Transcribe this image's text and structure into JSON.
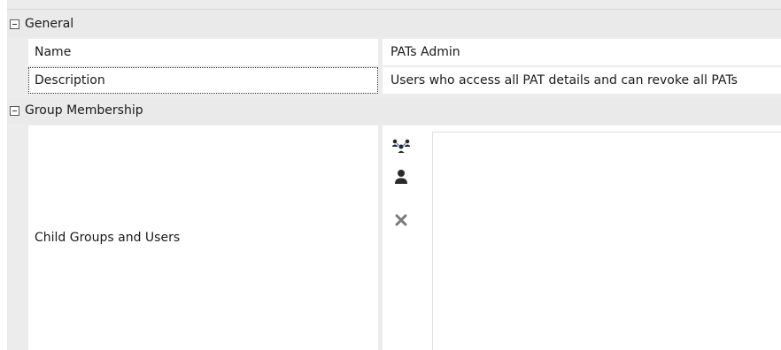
{
  "categories": {
    "general": "General",
    "group_membership": "Group Membership"
  },
  "properties": {
    "name": {
      "label": "Name",
      "value": "PATs Admin"
    },
    "description": {
      "label": "Description",
      "value": "Users who access all PAT details and can revoke all PATs"
    },
    "child_groups_and_users": {
      "label": "Child Groups and Users"
    }
  },
  "icons": {
    "add_group": "group-add-icon",
    "add_user": "user-add-icon",
    "remove": "remove-x-icon"
  },
  "child_members": []
}
